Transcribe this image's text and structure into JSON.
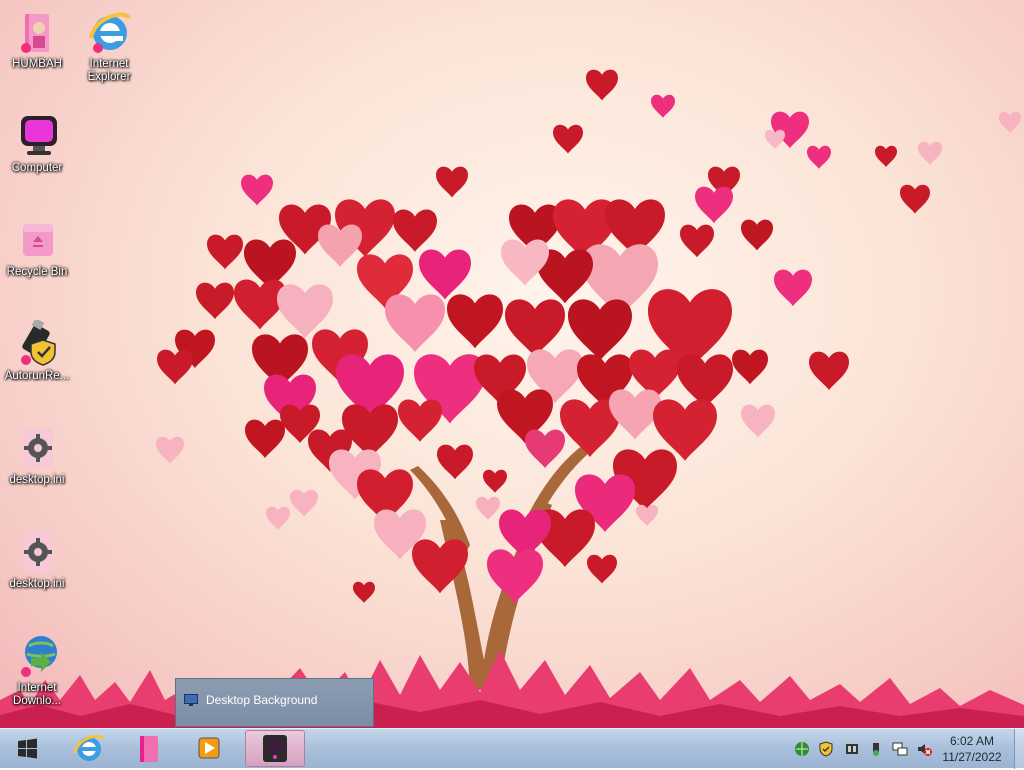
{
  "desktop": {
    "icons": [
      {
        "label": "HUMBAH",
        "icon": "folder-doll-icon"
      },
      {
        "label": "Internet Explorer",
        "icon": "internet-explorer-icon"
      },
      {
        "label": "Computer",
        "icon": "computer-icon"
      },
      {
        "label": "Recycle Bin",
        "icon": "recycle-bin-icon"
      },
      {
        "label": "AutorunRe...",
        "icon": "usb-shield-icon"
      },
      {
        "label": "desktop.ini",
        "icon": "settings-file-icon"
      },
      {
        "label": "desktop.ini",
        "icon": "settings-file-icon"
      },
      {
        "label": "Internet Downlo...",
        "icon": "download-manager-icon"
      }
    ]
  },
  "popup": {
    "label": "Desktop Background",
    "icon": "monitor-icon"
  },
  "taskbar": {
    "start": "windows-start-icon",
    "pinned": [
      "internet-explorer-icon",
      "folder-icon",
      "media-player-icon",
      "active-app-icon"
    ],
    "tray_icons": [
      "network-globe-icon",
      "shield-icon",
      "app-tray-icon",
      "usb-tray-icon",
      "network-icon",
      "volume-muted-icon"
    ],
    "time": "6:02 AM",
    "date": "11/27/2022"
  },
  "colors": {
    "heart_red": "#d21f2f",
    "heart_pink": "#f27a95",
    "taskbar": "#a9c0db"
  }
}
